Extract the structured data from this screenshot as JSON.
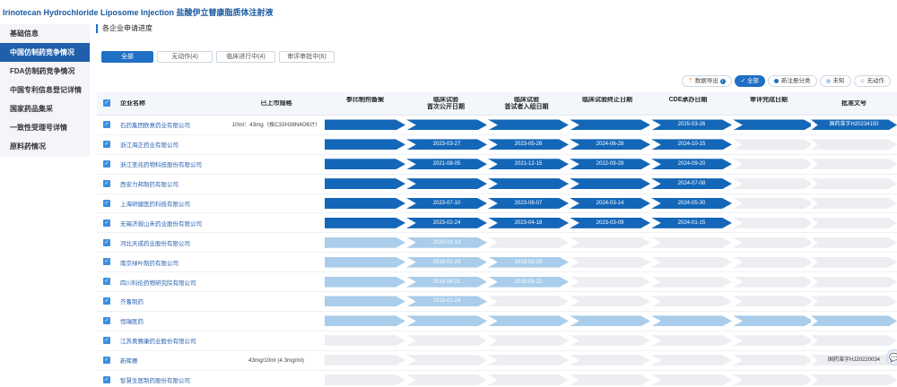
{
  "page_title": "Irinotecan Hydrochloride Liposome Injection 盐酸伊立替康脂质体注射液",
  "sidebar": {
    "items": [
      {
        "label": "基础信息",
        "active": false
      },
      {
        "label": "中国仿制药竞争情况",
        "active": true
      },
      {
        "label": "FDA仿制药竞争情况",
        "active": false
      },
      {
        "label": "中国专利信息登记详情",
        "active": false
      },
      {
        "label": "国家药品集采",
        "active": false
      },
      {
        "label": "一致性受理号详情",
        "active": false
      },
      {
        "label": "原料药情况",
        "active": false
      }
    ]
  },
  "section_label": "各企业申请进度",
  "tabs": [
    {
      "label": "全部",
      "active": true
    },
    {
      "label": "无动作(4)",
      "active": false
    },
    {
      "label": "临床进行中(4)",
      "active": false
    },
    {
      "label": "审评审批中(6)",
      "active": false
    }
  ],
  "filters": {
    "export_label": "数据导出",
    "all_label": "全部",
    "new_class_label": "新注册分类",
    "unknown_label": "未知",
    "no_action_label": "无动作",
    "colors": {
      "new_class": "#1f6fc5",
      "unknown": "#a9cdea",
      "no_action": "#e3e6eb"
    }
  },
  "table": {
    "headers": {
      "name": "企业名称",
      "spec": "已上市规格",
      "stages": [
        "参比制剂备案",
        "临床试验\n首次公开日期",
        "临床试验\n首试者入组日期",
        "临床试验终止日期",
        "CDE承办日期",
        "审评完成日期",
        "审评结论"
      ],
      "approval": "批准文号"
    },
    "rows": [
      {
        "name": "石药集团欧意药业有限公司",
        "spec": "10ml：43mg（按C33H38N4O6计）",
        "color": "d",
        "filled": 7,
        "dates": [
          "",
          "",
          "",
          "",
          "2025-03-26",
          "",
          ""
        ],
        "approval": "国药准字H20234150",
        "approval_color": "d"
      },
      {
        "name": "浙江海正药业有限公司",
        "spec": "",
        "color": "d",
        "filled": 5,
        "dates": [
          "",
          "2023-03-27",
          "2023-05-26",
          "2024-06-28",
          "2024-10-15",
          "",
          ""
        ],
        "approval": "",
        "approval_color": "g"
      },
      {
        "name": "浙江圣兆药物科技股份有限公司",
        "spec": "",
        "color": "d",
        "filled": 5,
        "dates": [
          "",
          "2021-08-05",
          "2021-12-15",
          "2022-09-28",
          "2024-09-20",
          "",
          ""
        ],
        "approval": "",
        "approval_color": "g"
      },
      {
        "name": "西安力邦制药有限公司",
        "spec": "",
        "color": "d",
        "filled": 5,
        "dates": [
          "",
          "",
          "",
          "",
          "2024-07-08",
          "",
          ""
        ],
        "approval": "",
        "approval_color": "g"
      },
      {
        "name": "上海研健医药科技有限公司",
        "spec": "",
        "color": "d",
        "filled": 5,
        "dates": [
          "",
          "2023-07-10",
          "2023-08-07",
          "2024-03-14",
          "2024-05-30",
          "",
          ""
        ],
        "approval": "",
        "approval_color": "g"
      },
      {
        "name": "无锡济煜山禾药业股份有限公司",
        "spec": "",
        "color": "d",
        "filled": 5,
        "dates": [
          "",
          "2023-02-24",
          "2023-04-18",
          "2023-03-09",
          "2024-01-15",
          "",
          ""
        ],
        "approval": "",
        "approval_color": "g"
      },
      {
        "name": "河北天成药业股份有限公司",
        "spec": "",
        "color": "l",
        "filled": 2,
        "dates": [
          "",
          "2020-01-13",
          "",
          "",
          "",
          "",
          ""
        ],
        "approval": "",
        "approval_color": "g"
      },
      {
        "name": "南京绿叶制药有限公司",
        "spec": "",
        "color": "l",
        "filled": 3,
        "dates": [
          "",
          "2019-01-24",
          "2019-02-25",
          "",
          "",
          "",
          ""
        ],
        "approval": "",
        "approval_color": "g"
      },
      {
        "name": "四川科伦药物研究院有限公司",
        "spec": "",
        "color": "l",
        "filled": 3,
        "dates": [
          "",
          "2018-09-21",
          "2018-06-22",
          "",
          "",
          "",
          ""
        ],
        "approval": "",
        "approval_color": "g"
      },
      {
        "name": "齐鲁制药",
        "spec": "",
        "color": "l",
        "filled": 2,
        "dates": [
          "",
          "2018-01-24",
          "",
          "",
          "",
          "",
          ""
        ],
        "approval": "",
        "approval_color": "g"
      },
      {
        "name": "恒瑞医药",
        "spec": "",
        "color": "l",
        "filled": 7,
        "dates": [
          "",
          "",
          "",
          "",
          "",
          "",
          ""
        ],
        "approval": "",
        "approval_color": "l"
      },
      {
        "name": "江苏奥赛康药业股份有限公司",
        "spec": "",
        "color": "g",
        "filled": 0,
        "dates": [
          "",
          "",
          "",
          "",
          "",
          "",
          ""
        ],
        "approval": "",
        "approval_color": "g"
      },
      {
        "name": "新晖赛",
        "spec": "43mg/10ml (4.3mg/ml)",
        "color": "g",
        "filled": 0,
        "dates": [
          "",
          "",
          "",
          "",
          "",
          "",
          ""
        ],
        "approval": "国药准字HJ20220034",
        "approval_color": "g"
      },
      {
        "name": "智慧生医制药股份有限公司",
        "spec": "",
        "color": "g",
        "filled": 0,
        "dates": [
          "",
          "",
          "",
          "",
          "",
          "",
          ""
        ],
        "approval": "",
        "approval_color": "g"
      }
    ]
  },
  "help_icon": "chat-bubble-icon"
}
